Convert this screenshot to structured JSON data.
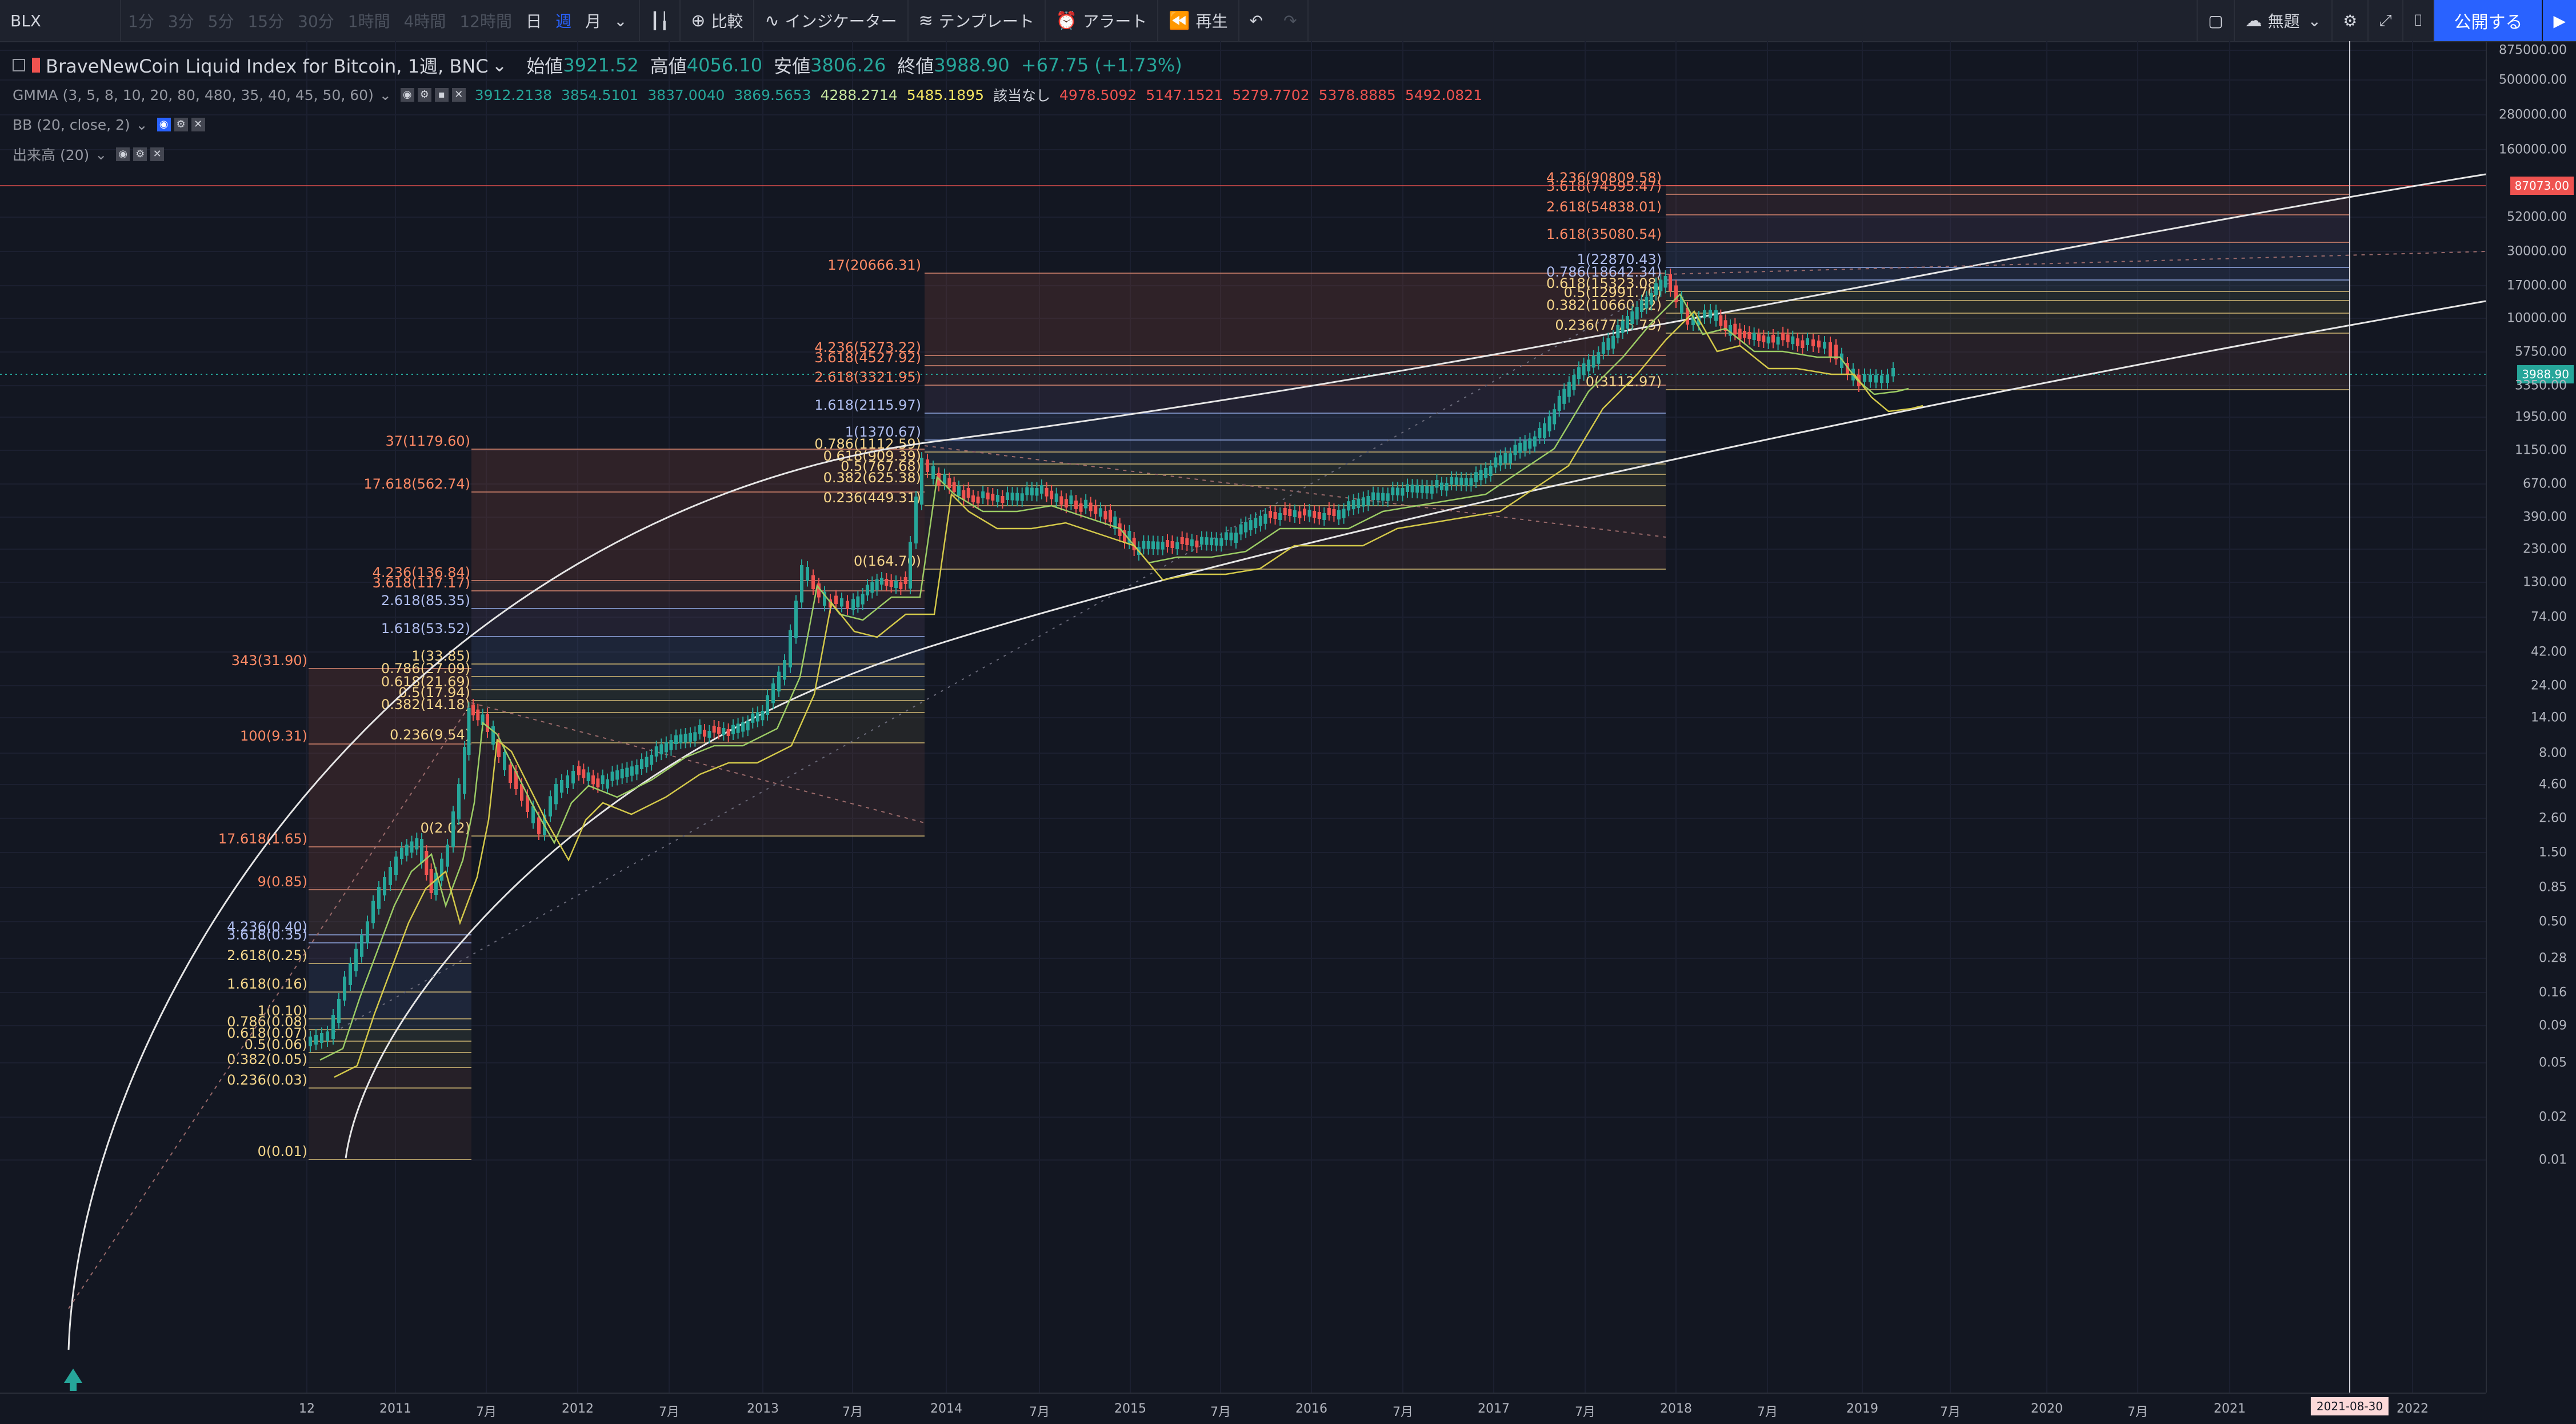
{
  "toolbar": {
    "symbol": "BLX",
    "intervals": [
      "1分",
      "3分",
      "5分",
      "15分",
      "30分",
      "1時間",
      "4時間",
      "12時間",
      "日",
      "週",
      "月"
    ],
    "selected_interval": "週",
    "compare": "比較",
    "indicators": "インジケーター",
    "templates": "テンプレート",
    "alert": "アラート",
    "replay": "再生",
    "layout_name": "無題",
    "publish": "公開する"
  },
  "legend": {
    "title": "BraveNewCoin Liquid Index for Bitcoin, 1週, BNC",
    "open_label": "始値",
    "open": "3921.52",
    "high_label": "高値",
    "high": "4056.10",
    "low_label": "安値",
    "low": "3806.26",
    "close_label": "終値",
    "close": "3988.90",
    "change": "+67.75 (+1.73%)",
    "gmma_name": "GMMA (3, 5, 8, 10, 20, 80, 480, 35, 40, 45, 50, 60)",
    "gmma_values": [
      "3912.2138",
      "3854.5101",
      "3837.0040",
      "3869.5653",
      "4288.2714",
      "5485.1895",
      "該当なし",
      "4978.5092",
      "5147.1521",
      "5279.7702",
      "5378.8885",
      "5492.0821"
    ],
    "bb_name": "BB (20, close, 2)",
    "volume_name": "出来高 (20)"
  },
  "colors": {
    "background": "#131722",
    "up": "#26a69a",
    "down": "#ef5350",
    "fib_label": "#ff8a65",
    "price_badge": "#26a69a",
    "line_badge": "#ef5350"
  },
  "y_axis": {
    "ticks": [
      "875000.00",
      "500000.00",
      "280000.00",
      "160000.00",
      "87073.00",
      "52000.00",
      "30000.00",
      "17000.00",
      "10000.00",
      "5750.00",
      "3988.90",
      "3350.00",
      "1950.00",
      "1150.00",
      "670.00",
      "390.00",
      "230.00",
      "130.00",
      "74.00",
      "42.00",
      "24.00",
      "14.00",
      "8.00",
      "4.60",
      "2.60",
      "1.50",
      "0.85",
      "0.50",
      "0.28",
      "0.16",
      "0.09",
      "0.05",
      "0.02",
      "0.01"
    ],
    "current_price": "3988.90",
    "line_price": "87073.00"
  },
  "x_axis": {
    "ticks": [
      "12",
      "2011",
      "7月",
      "2012",
      "7月",
      "2013",
      "7月",
      "2014",
      "7月",
      "2015",
      "7月",
      "2016",
      "7月",
      "2017",
      "7月",
      "2018",
      "7月",
      "2019",
      "7月",
      "2020",
      "7月",
      "2021",
      "2021-08-30",
      "2022"
    ]
  },
  "fib_sets": [
    {
      "labels": [
        "343(31.90)",
        "100(9.31)",
        "17.618(1.65)",
        "9(0.85)",
        "4.236(0.40)",
        "3.618(0.35)",
        "2.618(0.25)",
        "1.618(0.16)",
        "1(0.10)",
        "0.786(0.08)",
        "0.618(0.07)",
        "0.5(0.06)",
        "0.382(0.05)",
        "0.236(0.03)",
        "0(0.01)"
      ]
    },
    {
      "labels": [
        "37(1179.60)",
        "17.618(562.74)",
        "4.236(136.84)",
        "3.618(117.17)",
        "2.618(85.35)",
        "1.618(53.52)",
        "1(33.85)",
        "0.786(27.09)",
        "0.618(21.69)",
        "0.5(17.94)",
        "0.382(14.18)",
        "0.236(9.54)",
        "0(2.02)"
      ]
    },
    {
      "labels": [
        "17(20666.31)",
        "4.236(5273.22)",
        "3.618(4527.92)",
        "2.618(3321.95)",
        "1.618(2115.97)",
        "1(1370.67)",
        "0.786(1112.59)",
        "0.618(909.39)",
        "0.5(767.68)",
        "0.382(625.38)",
        "0.236(449.31)",
        "0(164.70)"
      ]
    },
    {
      "labels": [
        "4.236(90809.58)",
        "3.618(74595.47)",
        "2.618(54838.01)",
        "1.618(35080.54)",
        "1(22870.43)",
        "0.786(18642.34)",
        "0.618(15323.08)",
        "0.5(12991.70)",
        "0.382(10660.32)",
        "0.236(7775.73)",
        "0(3112.97)"
      ]
    }
  ]
}
